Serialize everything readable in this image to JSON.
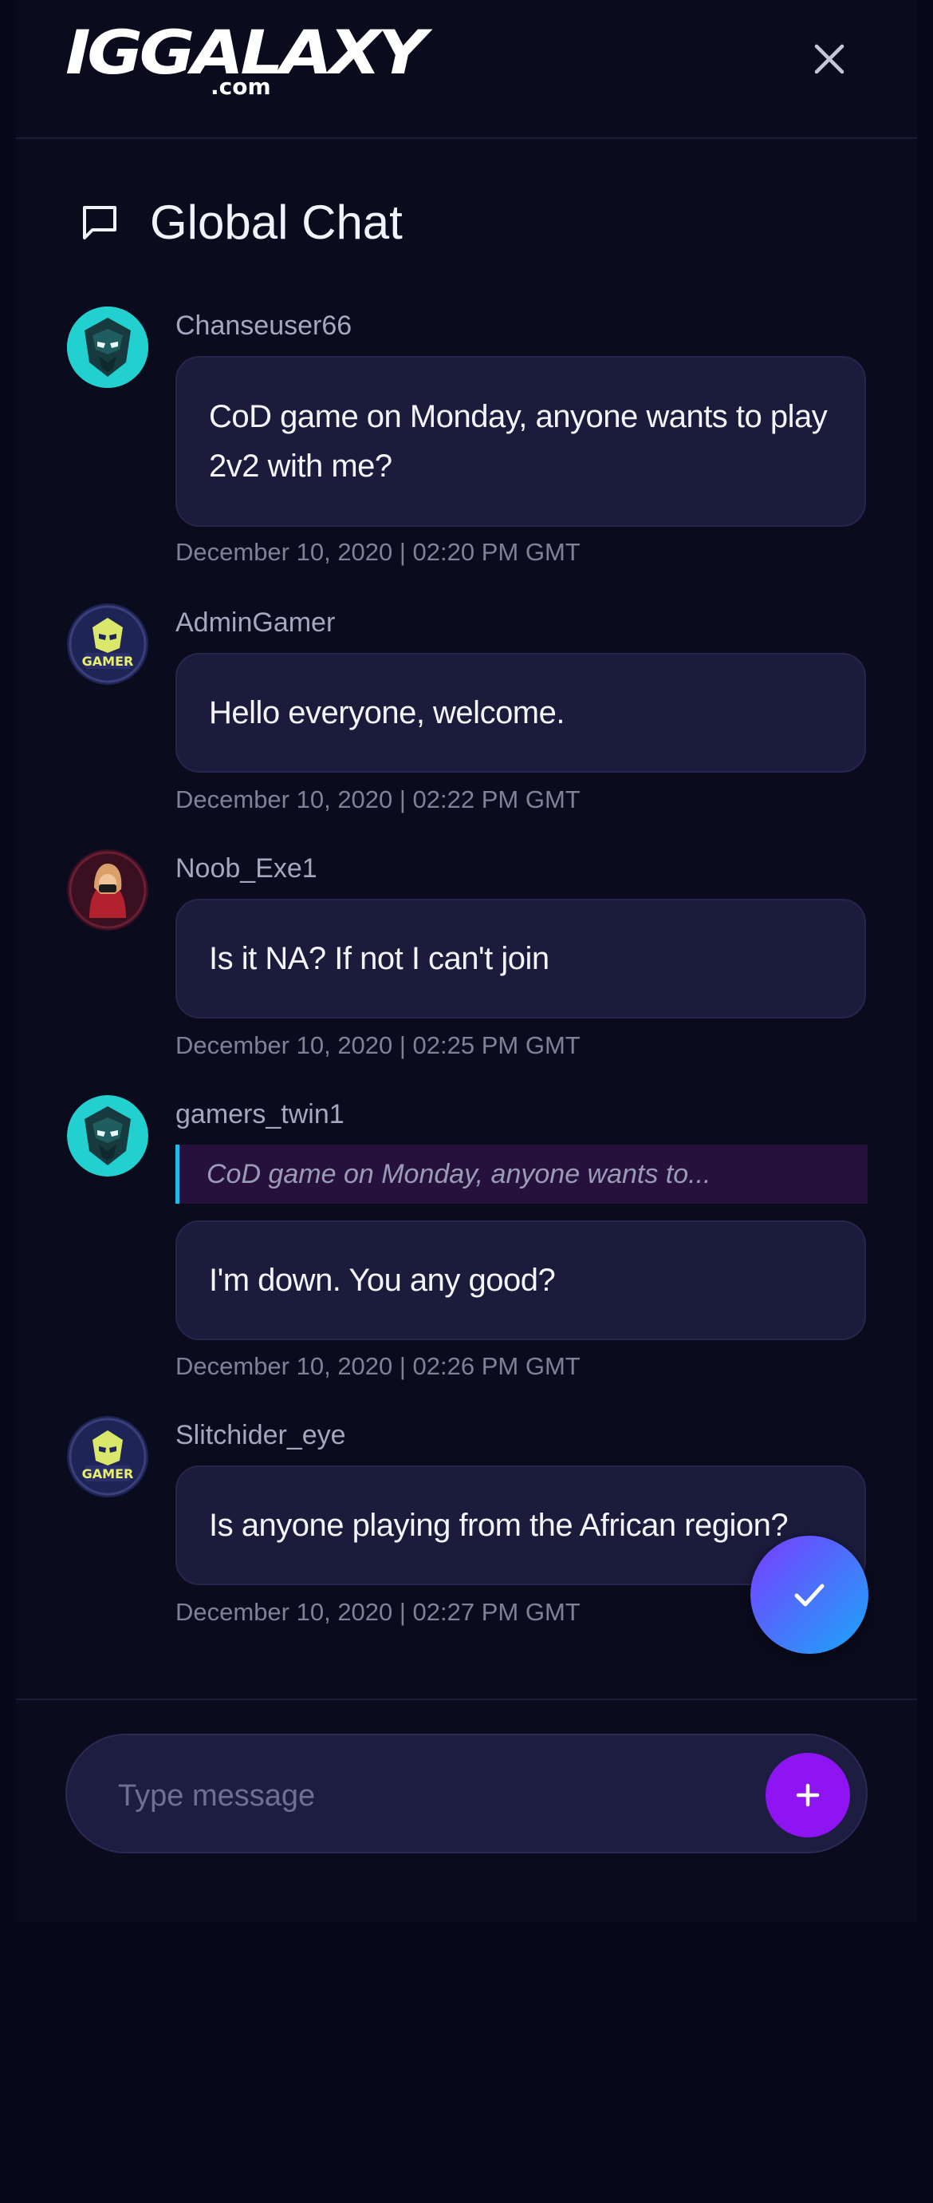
{
  "header": {
    "brand": "IGGALAXY",
    "tld": ".com",
    "close_icon": "close-icon"
  },
  "chat": {
    "title": "Global Chat",
    "title_icon": "chat-bubble-icon"
  },
  "messages": [
    {
      "username": "Chanseuser66",
      "text": "CoD game on Monday, anyone wants to play 2v2 with me?",
      "timestamp": "December 10, 2020 | 02:20 PM GMT",
      "avatar": "helmet-avatar-icon"
    },
    {
      "username": "AdminGamer",
      "text": "Hello everyone, welcome.",
      "timestamp": "December 10, 2020 | 02:22 PM GMT",
      "avatar": "gamer-badge-avatar-icon",
      "avatar_text": "GAMER"
    },
    {
      "username": "Noob_Exe1",
      "text": "Is it NA? If not I can't join",
      "timestamp": "December 10, 2020 | 02:25 PM GMT",
      "avatar": "hooded-figure-avatar-icon"
    },
    {
      "username": "gamers_twin1",
      "quote": "CoD game on Monday, anyone wants to...",
      "text": "I'm down. You any good?",
      "timestamp": "December 10, 2020 | 02:26 PM GMT",
      "avatar": "helmet-avatar-icon"
    },
    {
      "username": "Slitchider_eye",
      "text": "Is anyone playing from the African region?",
      "timestamp": "December 10, 2020 | 02:27 PM GMT",
      "avatar": "gamer-badge-avatar-icon",
      "avatar_text": "GAMER"
    }
  ],
  "fab": {
    "icon": "checkmark-icon"
  },
  "composer": {
    "placeholder": "Type message",
    "value": "",
    "send_icon": "plus-icon"
  },
  "colors": {
    "background": "#0b0b1e",
    "bubble": "#1b1b3c",
    "accent_purple": "#8e14f2",
    "accent_cyan": "#22b9e8",
    "quote_bg": "#26113d"
  }
}
